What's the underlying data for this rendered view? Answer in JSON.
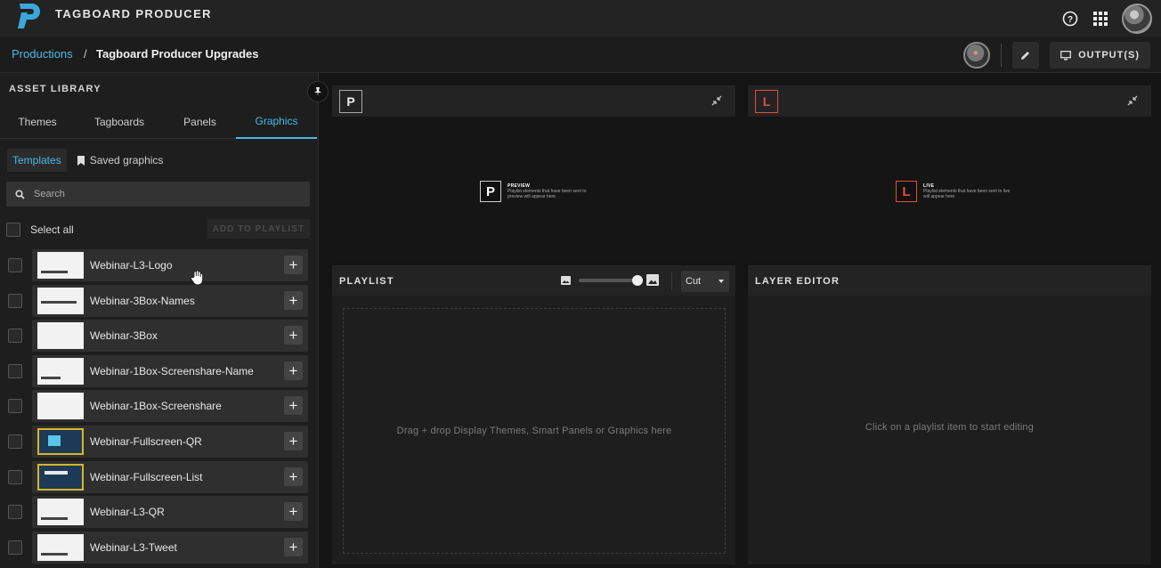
{
  "app": {
    "title": "TAGBOARD PRODUCER",
    "accent_color": "#4cb8e6",
    "logo_icon": "tagboard-logo"
  },
  "topbar": {
    "icons": [
      "help-icon",
      "apps-grid-icon",
      "user-avatar"
    ]
  },
  "breadcrumb": {
    "root": "Productions",
    "separator": "/",
    "current": "Tagboard Producer Upgrades"
  },
  "toolbar": {
    "output_label": "OUTPUT(S)",
    "icons": [
      "edit-icon",
      "monitor-icon"
    ]
  },
  "sidebar": {
    "title": "ASSET LIBRARY",
    "tabs": [
      {
        "label": "Themes",
        "active": false
      },
      {
        "label": "Tagboards",
        "active": false
      },
      {
        "label": "Panels",
        "active": false
      },
      {
        "label": "Graphics",
        "active": true
      }
    ],
    "subtabs": {
      "templates": "Templates",
      "saved": "Saved graphics"
    },
    "search_placeholder": "Search",
    "select_all": "Select all",
    "add_to_playlist": "ADD TO PLAYLIST",
    "assets": [
      {
        "name": "Webinar-L3-Logo",
        "thumb": "light"
      },
      {
        "name": "Webinar-3Box-Names",
        "thumb": "light"
      },
      {
        "name": "Webinar-3Box",
        "thumb": "light"
      },
      {
        "name": "Webinar-1Box-Screenshare-Name",
        "thumb": "light"
      },
      {
        "name": "Webinar-1Box-Screenshare",
        "thumb": "light"
      },
      {
        "name": "Webinar-Fullscreen-QR",
        "thumb": "dark"
      },
      {
        "name": "Webinar-Fullscreen-List",
        "thumb": "dark"
      },
      {
        "name": "Webinar-L3-QR",
        "thumb": "light"
      },
      {
        "name": "Webinar-L3-Tweet",
        "thumb": "light"
      }
    ],
    "add_symbol": "+"
  },
  "preview": {
    "badge": "P",
    "mini_title": "PREVIEW",
    "mini_text": "Playlist elements that have been sent to preview will appear here"
  },
  "live": {
    "badge": "L",
    "badge_color": "#e0503c",
    "mini_title": "LIVE",
    "mini_text": "Playlist elements that have been sent to live will appear here"
  },
  "playlist": {
    "title": "PLAYLIST",
    "transition": "Cut",
    "dropzone": "Drag + drop Display Themes, Smart Panels or Graphics here"
  },
  "layer_editor": {
    "title": "LAYER EDITOR",
    "empty_message": "Click on a playlist item to start editing"
  }
}
